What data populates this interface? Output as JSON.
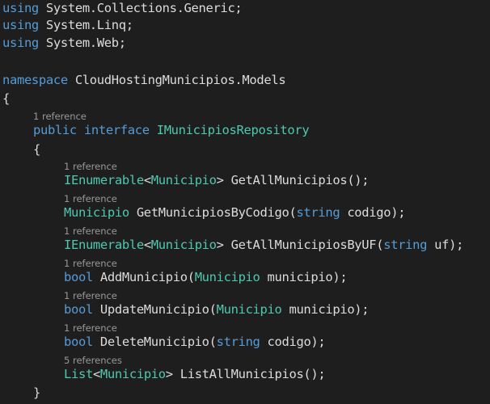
{
  "colors": {
    "background": "#1e1e1e",
    "keyword": "#569cd6",
    "type": "#4ec9b0",
    "text": "#dcdcdc",
    "codelens": "#999999"
  },
  "usings": [
    {
      "kw": "using",
      "ns": " System.Collections.Generic;"
    },
    {
      "kw": "using",
      "ns": " System.Linq;"
    },
    {
      "kw": "using",
      "ns": " System.Web;"
    }
  ],
  "namespace_decl": {
    "kw": "namespace",
    "name": " CloudHostingMunicipios.Models"
  },
  "brace_open": "{",
  "brace_close": "}",
  "interface_decl": {
    "lens": "1 reference",
    "kw1": "public",
    "kw2": " interface",
    "name": " IMunicipiosRepository"
  },
  "members": [
    {
      "lens": "1 reference",
      "t1": "IEnumerable",
      "t2": "<",
      "t3": "Municipio",
      "t4": "> GetAllMunicipios();"
    },
    {
      "lens": "1 reference",
      "t1": "Municipio",
      "t2": " GetMunicipiosByCodigo(",
      "t3": "string",
      "t4": " codigo);"
    },
    {
      "lens": "1 reference",
      "t1": "IEnumerable",
      "t2": "<",
      "t3": "Municipio",
      "t4": "> GetAllMunicipiosByUF(",
      "t5": "string",
      "t6": " uf);"
    },
    {
      "lens": "1 reference",
      "t1": "bool",
      "t2": " AddMunicipio(",
      "t3": "Municipio",
      "t4": " municipio);"
    },
    {
      "lens": "1 reference",
      "t1": "bool",
      "t2": " UpdateMunicipio(",
      "t3": "Municipio",
      "t4": " municipio);"
    },
    {
      "lens": "1 reference",
      "t1": "bool",
      "t2": " DeleteMunicipio(",
      "t3": "string",
      "t4": " codigo);"
    },
    {
      "lens": "5 references",
      "t1": "List",
      "t2": "<",
      "t3": "Municipio",
      "t4": "> ListAllMunicipios();"
    }
  ]
}
